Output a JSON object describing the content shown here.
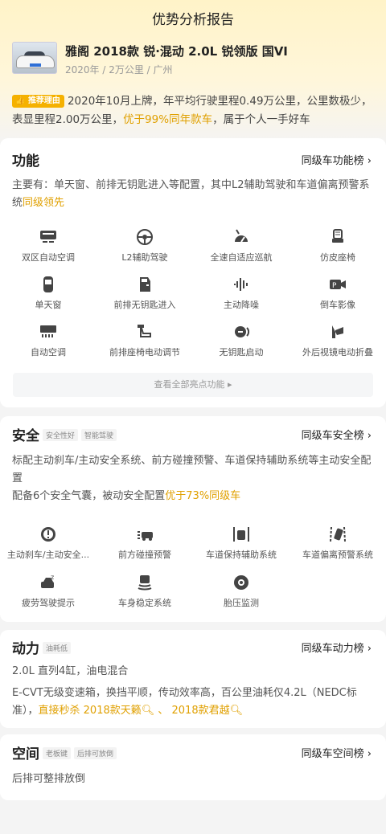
{
  "page": {
    "title": "优势分析报告"
  },
  "car": {
    "name": "雅阁 2018款 锐·混动 2.0L 锐领版 国VI",
    "meta": "2020年 / 2万公里 / 广州"
  },
  "reason": {
    "badge": "推荐理由",
    "text_a": "2020年10月上牌，年平均行驶里程0.49万公里，公里数极少，表显里程2.00万公里，",
    "highlight": "优于99%同年款车",
    "text_b": "，属于个人一手好车"
  },
  "function": {
    "title": "功能",
    "link": "同级车功能榜 ›",
    "desc": "主要有：单天窗、前排无钥匙进入等配置，其中L2辅助驾驶和车道偏离预警系统",
    "desc_hl": "同级领先",
    "items": [
      {
        "label": "双区自动空调",
        "icon": "dual-zone-ac-icon"
      },
      {
        "label": "L2辅助驾驶",
        "icon": "l2-assist-icon"
      },
      {
        "label": "全速自适应巡航",
        "icon": "adaptive-cruise-icon"
      },
      {
        "label": "仿皮座椅",
        "icon": "leather-seat-icon"
      },
      {
        "label": "单天窗",
        "icon": "sunroof-icon"
      },
      {
        "label": "前排无钥匙进入",
        "icon": "keyless-entry-icon"
      },
      {
        "label": "主动降噪",
        "icon": "noise-cancel-icon"
      },
      {
        "label": "倒车影像",
        "icon": "reverse-camera-icon"
      },
      {
        "label": "自动空调",
        "icon": "auto-ac-icon"
      },
      {
        "label": "前排座椅电动调节",
        "icon": "power-seat-icon"
      },
      {
        "label": "无钥匙启动",
        "icon": "keyless-start-icon"
      },
      {
        "label": "外后视镜电动折叠",
        "icon": "mirror-fold-icon"
      }
    ],
    "more": "查看全部亮点功能 ▸"
  },
  "safety": {
    "title": "安全",
    "tags": [
      "安全性好",
      "智能驾驶"
    ],
    "link": "同级车安全榜 ›",
    "desc1": "标配主动刹车/主动安全系统、前方碰撞预警、车道保持辅助系统等主动安全配置",
    "desc2_a": "配备6个安全气囊，被动安全配置",
    "desc2_hl": "优于73%同级车",
    "items": [
      {
        "label": "主动刹车/主动安全...",
        "icon": "active-brake-icon"
      },
      {
        "label": "前方碰撞预警",
        "icon": "collision-warning-icon"
      },
      {
        "label": "车道保持辅助系统",
        "icon": "lane-keep-icon"
      },
      {
        "label": "车道偏离预警系统",
        "icon": "lane-departure-icon"
      },
      {
        "label": "疲劳驾驶提示",
        "icon": "fatigue-alert-icon"
      },
      {
        "label": "车身稳定系统",
        "icon": "stability-control-icon"
      },
      {
        "label": "胎压监测",
        "icon": "tire-pressure-icon"
      }
    ]
  },
  "power": {
    "title": "动力",
    "tags": [
      "油耗低"
    ],
    "link": "同级车动力榜 ›",
    "desc1": "2.0L 直列4缸，油电混合",
    "desc2": "E-CVT无级变速箱，换挡平顺，传动效率高，百公里油耗仅4.2L（NEDC标准），",
    "desc2_hl": "直接秒杀 2018款天籁",
    "sep": " 、 ",
    "desc2_hl2": "2018款君越"
  },
  "space": {
    "title": "空间",
    "tags": [
      "老板键",
      "后排可放倒"
    ],
    "link": "同级车空间榜 ›",
    "desc": "后排可整排放倒"
  }
}
